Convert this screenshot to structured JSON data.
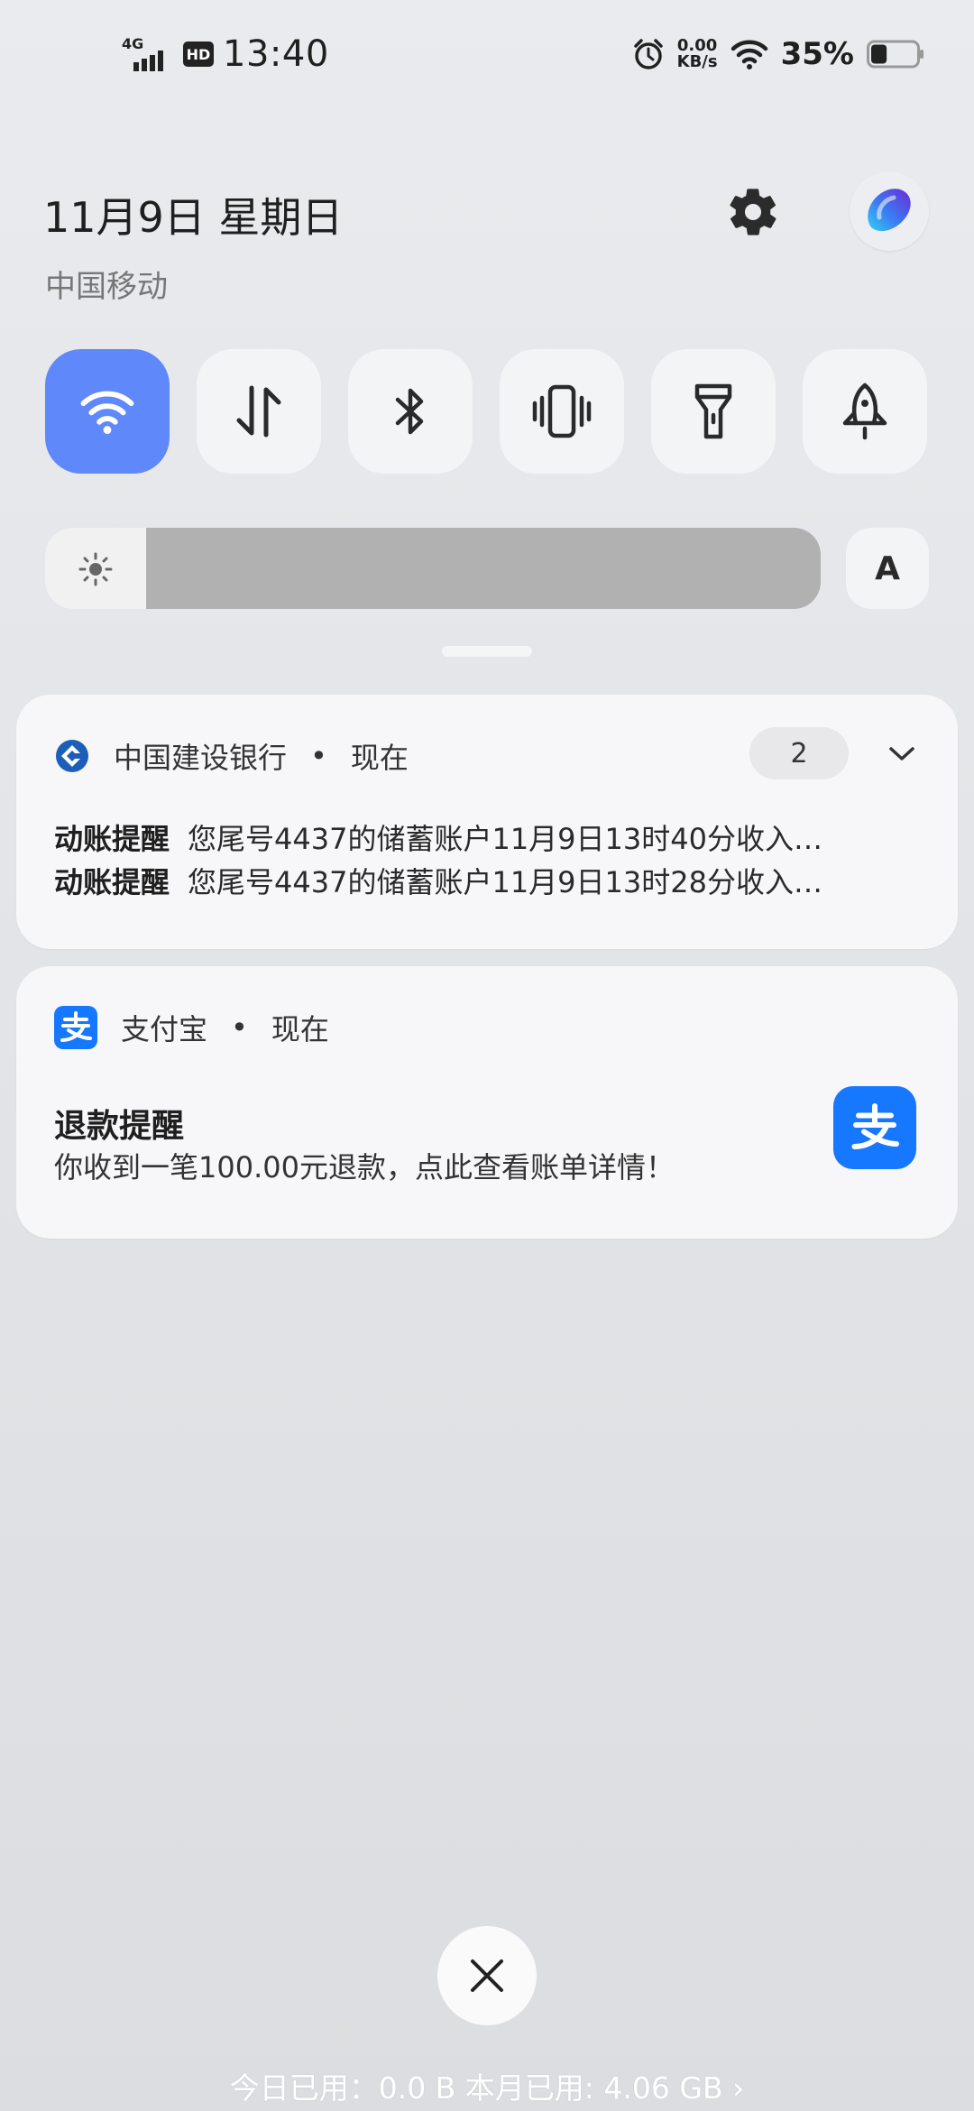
{
  "status_bar": {
    "network": "4G",
    "hd": "HD",
    "time": "13:40",
    "speed_value": "0.00",
    "speed_unit": "KB/s",
    "battery_percent": "35%",
    "battery_level": 0.35
  },
  "header": {
    "date": "11月9日 星期日",
    "carrier": "中国移动"
  },
  "quick_tiles": [
    {
      "name": "wifi",
      "active": true
    },
    {
      "name": "mobile-data",
      "active": false
    },
    {
      "name": "bluetooth",
      "active": false
    },
    {
      "name": "vibrate",
      "active": false
    },
    {
      "name": "flashlight",
      "active": false
    },
    {
      "name": "rocket",
      "active": false
    }
  ],
  "brightness": {
    "level": 0.13,
    "auto_label": "A"
  },
  "notifications": [
    {
      "app": "中国建设银行",
      "time": "现在",
      "count": "2",
      "messages": [
        {
          "title": "动账提醒",
          "text": "您尾号4437的储蓄账户11月9日13时40分收入…"
        },
        {
          "title": "动账提醒",
          "text": "您尾号4437的储蓄账户11月9日13时28分收入…"
        }
      ]
    },
    {
      "app": "支付宝",
      "time": "现在",
      "title": "退款提醒",
      "body": "你收到一笔100.00元退款，点此查看账单详情！"
    }
  ],
  "footer": {
    "data_usage": "今日已用：0.0 B 本月已用: 4.06 GB ›"
  },
  "colors": {
    "accent": "#5f88fb",
    "alipay": "#1677ff",
    "ccb": "#1d5fb8"
  },
  "icons": {
    "settings": "gear-icon",
    "alarm": "alarm-icon",
    "wifi": "wifi-icon",
    "clear": "close-icon"
  }
}
